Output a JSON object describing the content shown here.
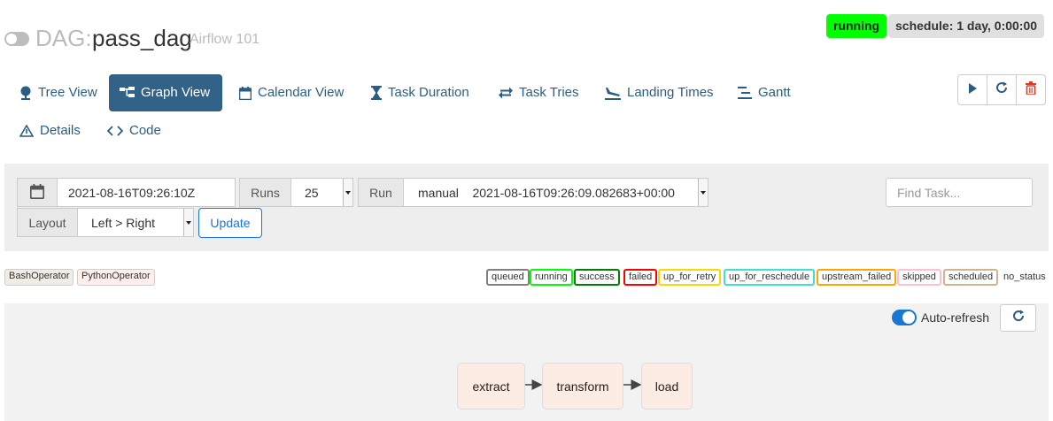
{
  "header": {
    "dag_prefix": "DAG:",
    "dag_name": "pass_dag",
    "owner": "Airflow 101",
    "status_badge": "running",
    "schedule_badge": "schedule: 1 day, 0:00:00"
  },
  "tabs": [
    {
      "label": "Tree View",
      "icon": "tree-icon"
    },
    {
      "label": "Graph View",
      "icon": "graph-icon",
      "active": true
    },
    {
      "label": "Calendar View",
      "icon": "calendar-icon"
    },
    {
      "label": "Task Duration",
      "icon": "hourglass-icon"
    },
    {
      "label": "Task Tries",
      "icon": "retry-arrows-icon"
    },
    {
      "label": "Landing Times",
      "icon": "plane-landing-icon"
    },
    {
      "label": "Gantt",
      "icon": "gantt-icon"
    },
    {
      "label": "Details",
      "icon": "warning-triangle-icon"
    },
    {
      "label": "Code",
      "icon": "code-icon"
    }
  ],
  "actions": [
    "play-icon",
    "refresh-icon",
    "trash-icon"
  ],
  "filters": {
    "base_date": "2021-08-16T09:26:10Z",
    "runs_label": "Runs",
    "runs_value": "25",
    "run_label": "Run",
    "run_value": "manual    2021-08-16T09:26:09.082683+00:00",
    "layout_label": "Layout",
    "layout_value": "Left > Right",
    "update_label": "Update",
    "find_placeholder": "Find Task..."
  },
  "operators": [
    {
      "label": "BashOperator",
      "color": "#f0ede4"
    },
    {
      "label": "PythonOperator",
      "color": "#ffefeb"
    }
  ],
  "states": [
    {
      "label": "queued",
      "color": "#808080"
    },
    {
      "label": "running",
      "color": "#00ff00"
    },
    {
      "label": "success",
      "color": "#008000"
    },
    {
      "label": "failed",
      "color": "#ff0000"
    },
    {
      "label": "up_for_retry",
      "color": "#ffd700"
    },
    {
      "label": "up_for_reschedule",
      "color": "#40e0d0"
    },
    {
      "label": "upstream_failed",
      "color": "#ffa500"
    },
    {
      "label": "skipped",
      "color": "#ffc0cb"
    },
    {
      "label": "scheduled",
      "color": "#d2b48c"
    },
    {
      "label": "no_status",
      "color": "#ffffff"
    }
  ],
  "graph": {
    "auto_refresh_label": "Auto-refresh",
    "nodes": [
      "extract",
      "transform",
      "load"
    ]
  }
}
